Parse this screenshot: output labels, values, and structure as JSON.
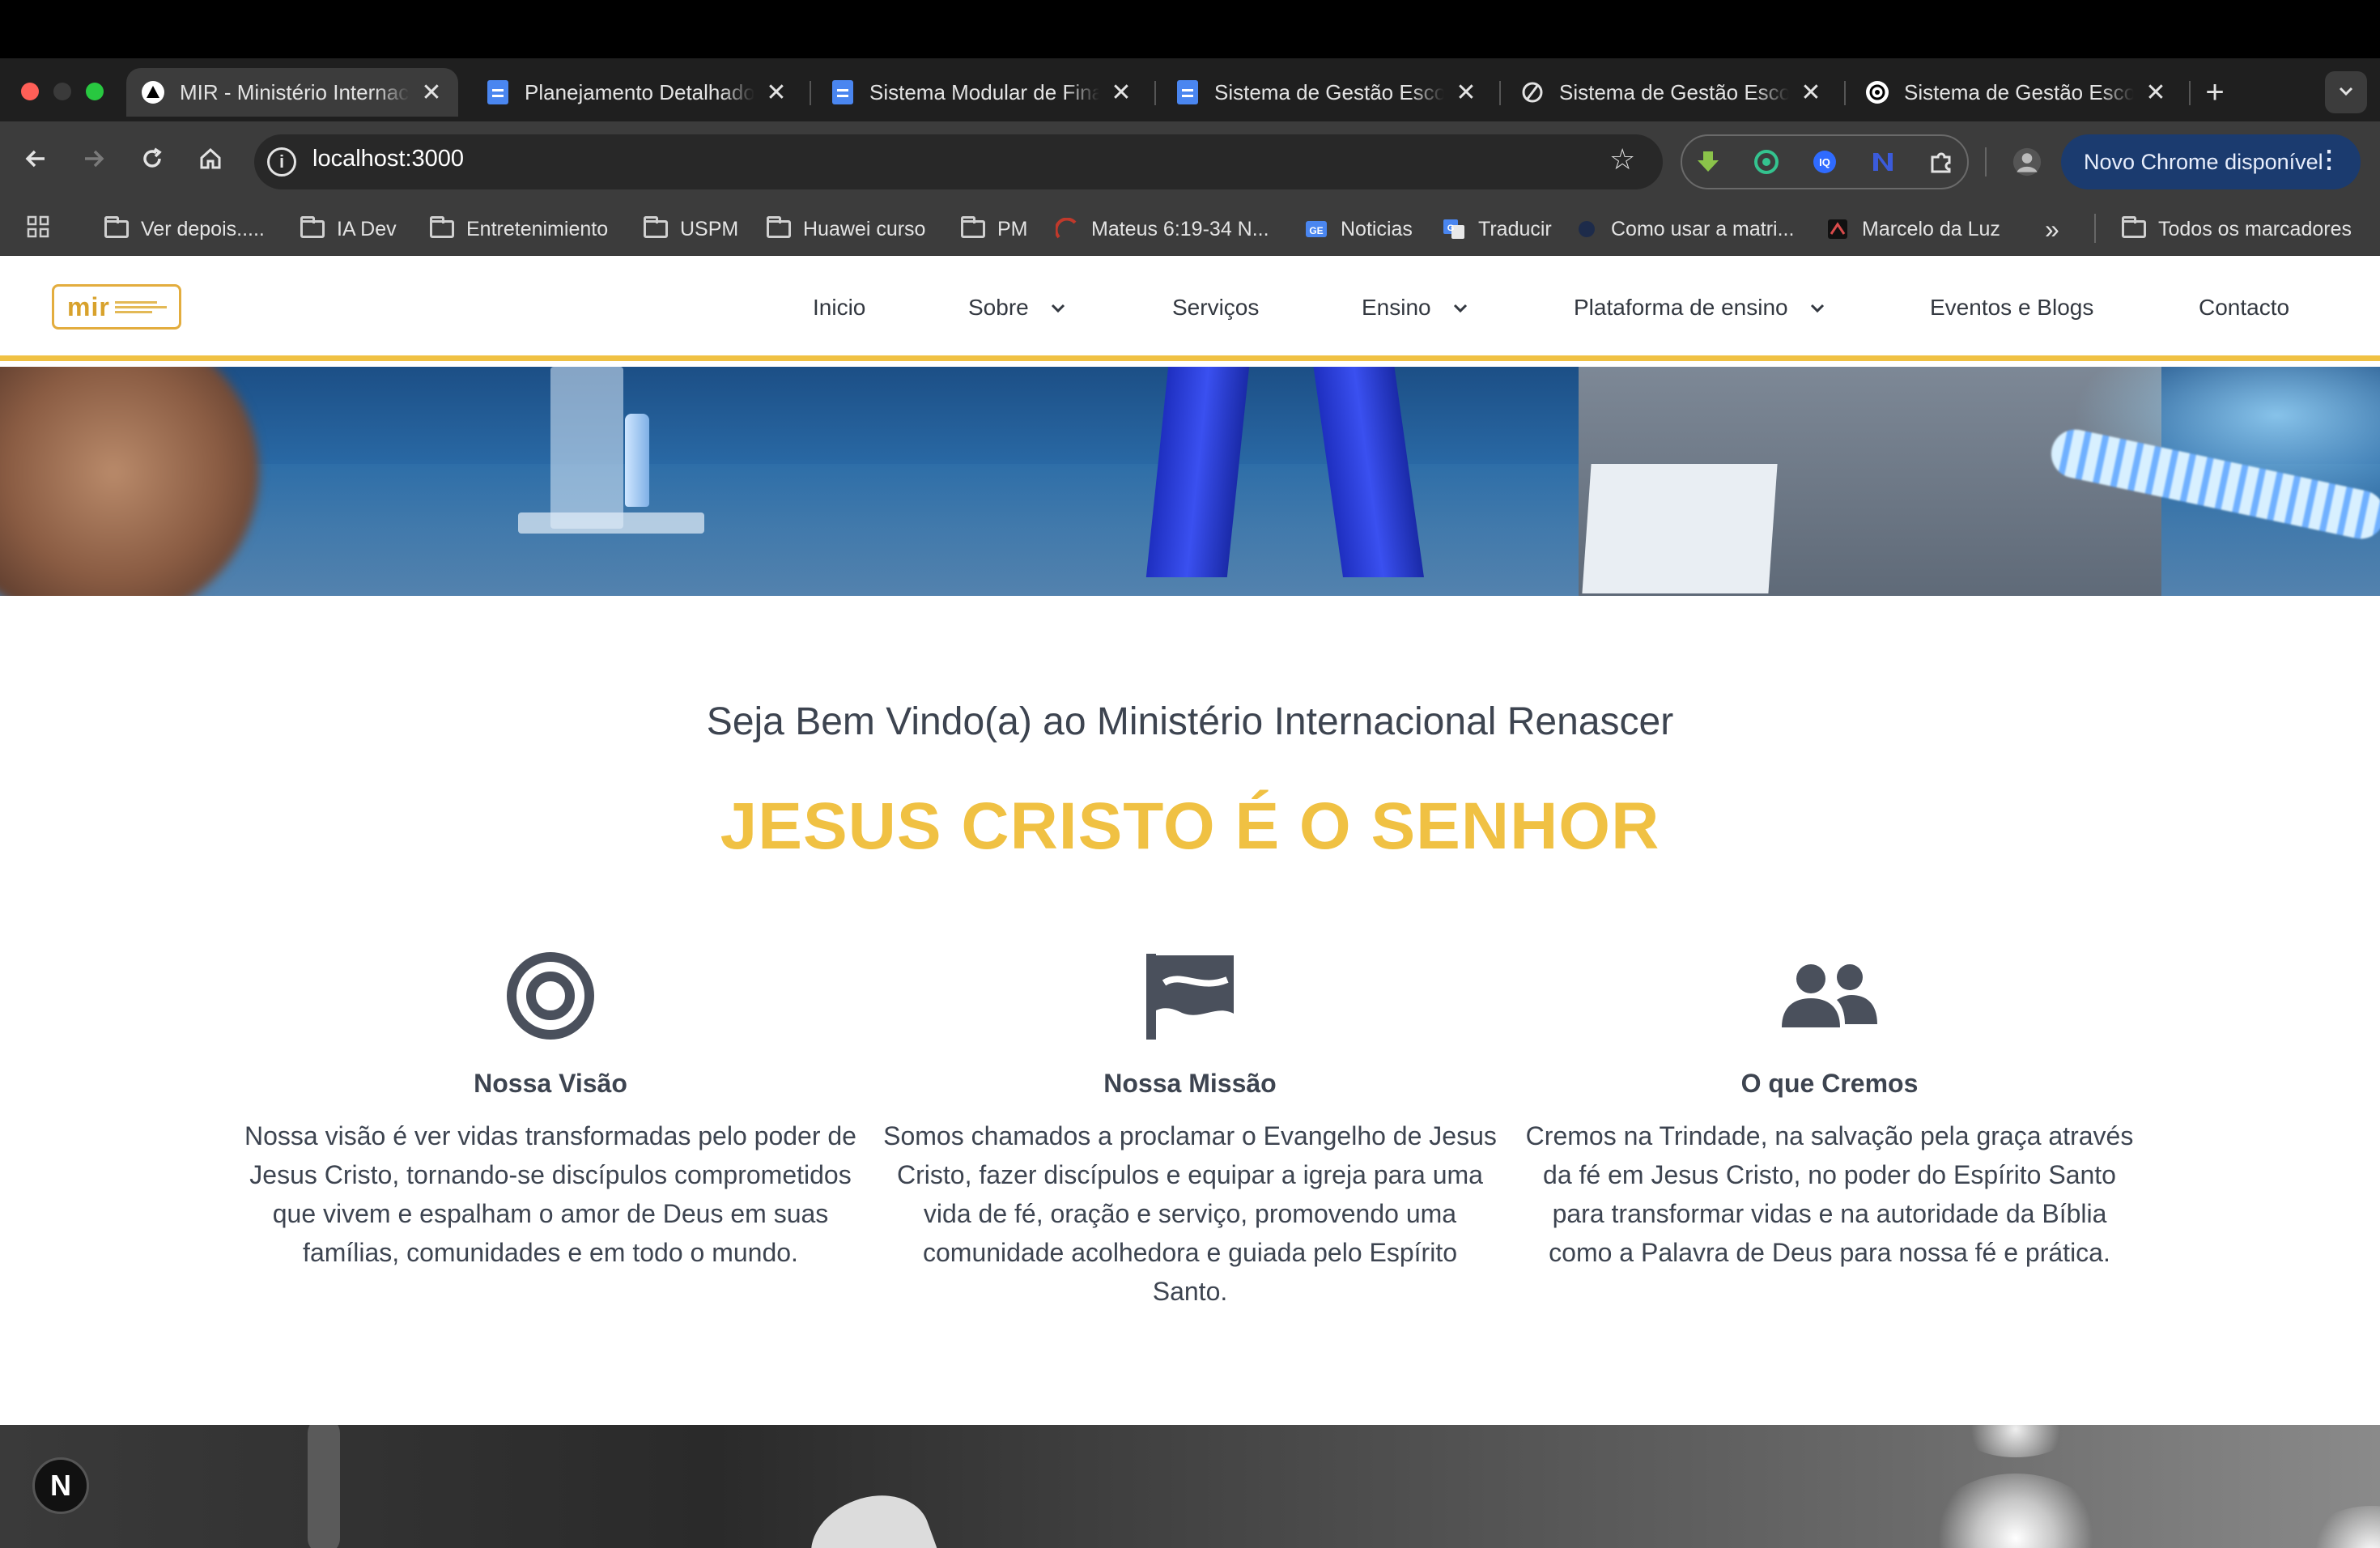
{
  "browser": {
    "tabs": [
      {
        "title": "MIR - Ministério Internacional Renascer",
        "icon": "triangle-icon",
        "active": true
      },
      {
        "title": "Planejamento Detalhado",
        "icon": "google-docs-icon"
      },
      {
        "title": "Sistema Modular de Finanças",
        "icon": "google-docs-icon"
      },
      {
        "title": "Sistema de Gestão Escolar",
        "icon": "google-docs-icon"
      },
      {
        "title": "Sistema de Gestão Escolar",
        "icon": "perplexity-icon"
      },
      {
        "title": "Sistema de Gestão Escolar",
        "icon": "openai-icon"
      }
    ],
    "new_tab": "+",
    "tab_close": "✕",
    "address": "localhost:3000",
    "update_button": "Novo Chrome disponível",
    "bookmarks": [
      {
        "label": "Ver depois.....",
        "icon": "folder-icon"
      },
      {
        "label": "IA Dev",
        "icon": "folder-icon"
      },
      {
        "label": "Entretenimiento",
        "icon": "folder-icon"
      },
      {
        "label": "USPM",
        "icon": "folder-icon"
      },
      {
        "label": "Huawei curso",
        "icon": "folder-icon"
      },
      {
        "label": "PM",
        "icon": "folder-icon"
      },
      {
        "label": "Mateus 6:19-34 N...",
        "icon": "page-icon"
      },
      {
        "label": "Noticias",
        "icon": "google-news-icon"
      },
      {
        "label": "Traducir",
        "icon": "google-translate-icon"
      },
      {
        "label": "Como usar a matri...",
        "icon": "page-icon"
      },
      {
        "label": "Marcelo da Luz",
        "icon": "page-icon"
      }
    ],
    "bookmarks_overflow": "»",
    "all_bookmarks": "Todos os marcadores"
  },
  "site": {
    "logo_text": "mir",
    "nav": [
      {
        "label": "Inicio"
      },
      {
        "label": "Sobre",
        "dropdown": true
      },
      {
        "label": "Serviços"
      },
      {
        "label": "Ensino",
        "dropdown": true
      },
      {
        "label": "Plataforma de ensino",
        "dropdown": true
      },
      {
        "label": "Eventos e Blogs"
      },
      {
        "label": "Contacto"
      }
    ],
    "welcome": "Seja Bem Vindo(a) ao Ministério Internacional Renascer",
    "motto": "JESUS CRISTO É O SENHOR",
    "features": [
      {
        "icon": "target-icon",
        "title": "Nossa Visão",
        "text": "Nossa visão é ver vidas transformadas pelo poder de Jesus Cristo, tornando-se discípulos comprometidos que vivem e espalham o amor de Deus em suas famílias, comunidades e em todo o mundo."
      },
      {
        "icon": "flag-icon",
        "title": "Nossa Missão",
        "text": "Somos chamados a proclamar o Evangelho de Jesus Cristo, fazer discípulos e equipar a igreja para uma vida de fé, oração e serviço, promovendo uma comunidade acolhedora e guiada pelo Espírito Santo."
      },
      {
        "icon": "people-icon",
        "title": "O que Cremos",
        "text": "Cremos na Trindade, na salvação pela graça através da fé em Jesus Cristo, no poder do Espírito Santo para transformar vidas e na autoridade da Bíblia como a Palavra de Deus para nossa fé e prática."
      }
    ],
    "next_badge": "N"
  },
  "colors": {
    "accent": "#f0c143",
    "text": "#3d4450",
    "chrome_dark": "#1f1f1f",
    "chrome_toolbar": "#3c3c3c"
  }
}
